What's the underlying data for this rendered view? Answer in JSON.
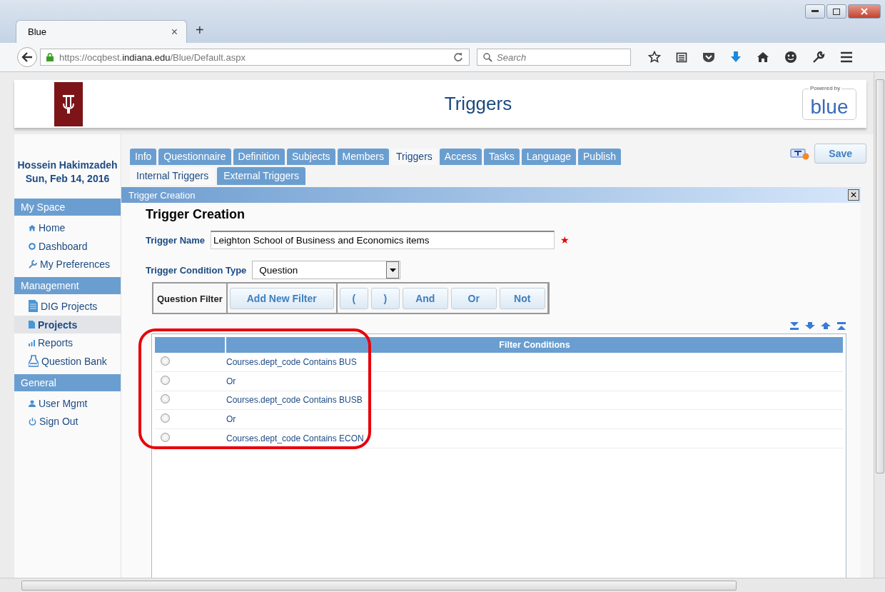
{
  "browser": {
    "tab_title": "Blue",
    "tab_close": "×",
    "new_tab": "+",
    "url_prefix": "https://ocqbest.",
    "url_domain": "indiana.edu",
    "url_path": "/Blue/Default.aspx",
    "search_placeholder": "Search"
  },
  "header": {
    "title": "Triggers",
    "powered_by": "Powered by",
    "brand": "blue"
  },
  "user": {
    "name": "Hossein Hakimzadeh",
    "date": "Sun, Feb 14, 2016"
  },
  "sidebar": {
    "sections": [
      {
        "title": "My Space",
        "items": [
          {
            "label": "Home",
            "selected": false
          },
          {
            "label": "Dashboard",
            "selected": false
          },
          {
            "label": "My Preferences",
            "selected": false
          }
        ]
      },
      {
        "title": "Management",
        "items": [
          {
            "label": "DIG Projects",
            "selected": false
          },
          {
            "label": "Projects",
            "selected": true
          },
          {
            "label": "Reports",
            "selected": false
          },
          {
            "label": "Question Bank",
            "selected": false
          }
        ]
      },
      {
        "title": "General",
        "items": [
          {
            "label": "User Mgmt",
            "selected": false
          },
          {
            "label": "Sign Out",
            "selected": false
          }
        ]
      }
    ]
  },
  "tabs": [
    {
      "label": "Info",
      "selected": false
    },
    {
      "label": "Questionnaire",
      "selected": false
    },
    {
      "label": "Definition",
      "selected": false
    },
    {
      "label": "Subjects",
      "selected": false
    },
    {
      "label": "Members",
      "selected": false
    },
    {
      "label": "Triggers",
      "selected": true
    },
    {
      "label": "Access",
      "selected": false
    },
    {
      "label": "Tasks",
      "selected": false
    },
    {
      "label": "Language",
      "selected": false
    },
    {
      "label": "Publish",
      "selected": false
    }
  ],
  "subtabs": [
    {
      "label": "Internal Triggers",
      "selected": true
    },
    {
      "label": "External Triggers",
      "selected": false
    }
  ],
  "save_button": "Save",
  "panel": {
    "title": "Trigger Creation",
    "close": "✕"
  },
  "form": {
    "heading": "Trigger Creation",
    "name_label": "Trigger Name",
    "name_value": "Leighton School of Business and Economics items",
    "required_mark": "★",
    "type_label": "Trigger Condition Type",
    "type_value": "Question",
    "filter_label": "Question Filter",
    "add_filter": "Add New Filter",
    "operators": [
      "(",
      ")",
      "And",
      "Or",
      "Not"
    ]
  },
  "table": {
    "column_header": "Filter Conditions",
    "rows": [
      {
        "text": "Courses.dept_code Contains BUS",
        "selected": false
      },
      {
        "text": "Or",
        "selected": false
      },
      {
        "text": "Courses.dept_code Contains BUSB",
        "selected": false
      },
      {
        "text": "Or",
        "selected": false
      },
      {
        "text": "Courses.dept_code Contains ECON",
        "selected": false
      }
    ]
  }
}
